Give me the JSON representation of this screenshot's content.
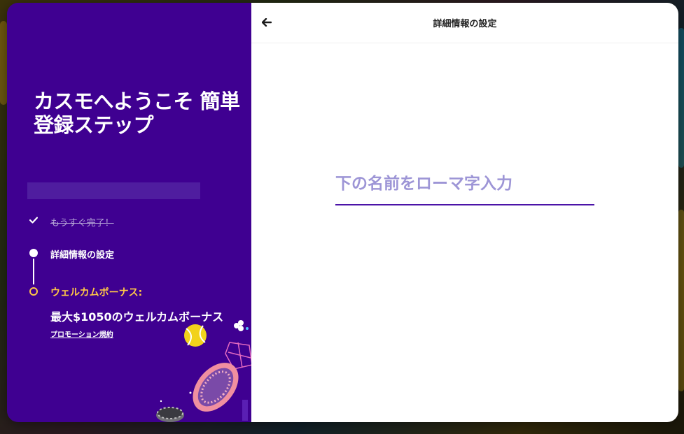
{
  "welcome": {
    "title": "カスモへようこそ 簡単登録ステップ"
  },
  "steps": [
    {
      "label": "もうすぐ完了！",
      "status": "done"
    },
    {
      "label": "詳細情報の設定",
      "status": "current"
    },
    {
      "label": "ウェルカムボーナス:",
      "status": "upcoming"
    }
  ],
  "bonus": {
    "amount": "最大$1050のウェルカムボーナス",
    "promo_link": "プロモーション規約"
  },
  "header": {
    "title": "詳細情報の設定"
  },
  "form": {
    "name_value": "",
    "name_placeholder": "下の名前をローマ字入力"
  },
  "colors": {
    "panel_purple": "#3f0091",
    "accent_gold": "#ffc846",
    "input_underline": "#4b13a8",
    "placeholder": "#9d95d6"
  },
  "icons": {
    "back": "arrow-left-icon",
    "done": "check-icon"
  }
}
